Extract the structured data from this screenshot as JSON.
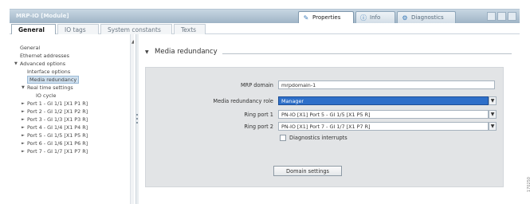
{
  "titlebar": {
    "title": "MRP-IO [Module]",
    "tabs": [
      {
        "label": "Properties",
        "icon": "properties-icon",
        "active": true
      },
      {
        "label": "Info",
        "icon": "info-icon",
        "active": false
      },
      {
        "label": "Diagnostics",
        "icon": "diagnostics-icon",
        "active": false
      }
    ]
  },
  "subtabs": [
    "General",
    "IO tags",
    "System constants",
    "Texts"
  ],
  "tree": [
    {
      "label": "General",
      "indent": 0,
      "arrow": ""
    },
    {
      "label": "Ethernet addresses",
      "indent": 0,
      "arrow": ""
    },
    {
      "label": "Advanced options",
      "indent": 0,
      "arrow": "▼"
    },
    {
      "label": "Interface options",
      "indent": 1,
      "arrow": ""
    },
    {
      "label": "Media redundancy",
      "indent": 1,
      "arrow": "",
      "selected": true
    },
    {
      "label": "Real time settings",
      "indent": 1,
      "arrow": "▼"
    },
    {
      "label": "IO cycle",
      "indent": 2,
      "arrow": ""
    },
    {
      "label": "Port 1 - GI 1/1 [X1 P1 R]",
      "indent": 1,
      "arrow": "►"
    },
    {
      "label": "Port 2 - GI 1/2 [X1 P2 R]",
      "indent": 1,
      "arrow": "►"
    },
    {
      "label": "Port 3 - GI 1/3 [X1 P3 R]",
      "indent": 1,
      "arrow": "►"
    },
    {
      "label": "Port 4 - GI 1/4 [X1 P4 R]",
      "indent": 1,
      "arrow": "►"
    },
    {
      "label": "Port 5 - GI 1/5 [X1 P5 R]",
      "indent": 1,
      "arrow": "►"
    },
    {
      "label": "Port 6 - GI 1/6 [X1 P6 R]",
      "indent": 1,
      "arrow": "►"
    },
    {
      "label": "Port 7 - GI 1/7 [X1 P7 R]",
      "indent": 1,
      "arrow": "►"
    }
  ],
  "section": {
    "title": "Media redundancy"
  },
  "form": {
    "mrp_domain_label": "MRP domain",
    "mrp_domain_value": "mrpdomain-1",
    "role_label": "Media redundancy role",
    "role_value": "Manager",
    "ring1_label": "Ring port 1",
    "ring1_value": "PN-IO [X1] Port 5 - GI 1/5 [X1 P5 R]",
    "ring2_label": "Ring port 2",
    "ring2_value": "PN-IO [X1] Port 7 - GI 1/7 [X1 P7 R]",
    "diag_label": "Diagnostics interrupts",
    "domain_button": "Domain settings"
  },
  "figure_id": "170250",
  "colors": {
    "titlebar": "#9fb4c6",
    "selected_field": "#2e6fc9",
    "panel": "#e2e4e6"
  }
}
